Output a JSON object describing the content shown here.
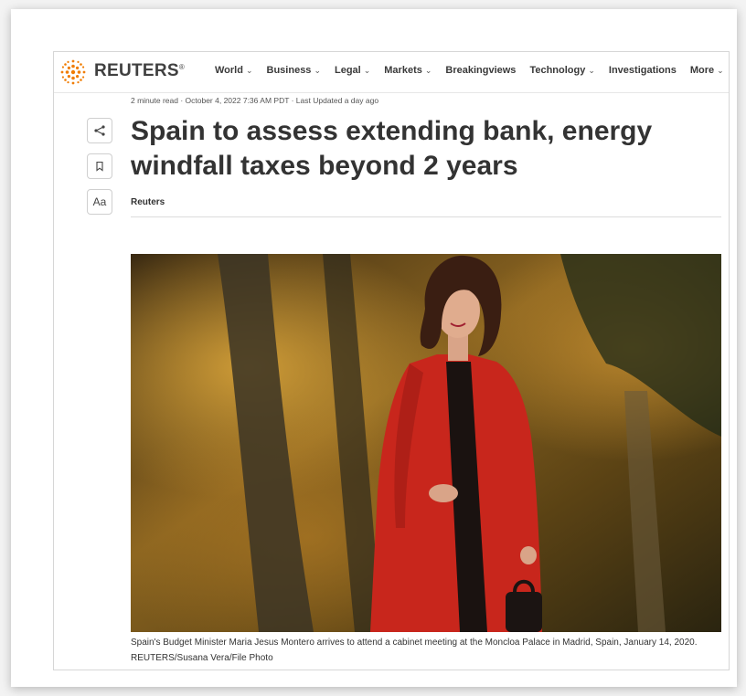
{
  "brand": {
    "name": "REUTERS",
    "mark": "®"
  },
  "nav": [
    {
      "label": "World",
      "dropdown": true
    },
    {
      "label": "Business",
      "dropdown": true
    },
    {
      "label": "Legal",
      "dropdown": true
    },
    {
      "label": "Markets",
      "dropdown": true
    },
    {
      "label": "Breakingviews",
      "dropdown": false
    },
    {
      "label": "Technology",
      "dropdown": true
    },
    {
      "label": "Investigations",
      "dropdown": false
    },
    {
      "label": "More",
      "dropdown": true
    }
  ],
  "article": {
    "meta": "2 minute read · October 4, 2022 7:36 AM PDT · Last Updated a day ago",
    "headline": "Spain to assess extending bank, energy windfall taxes beyond 2 years",
    "byline": "Reuters",
    "caption": "Spain's Budget Minister Maria Jesus Montero arrives to attend a cabinet meeting at the Moncloa Palace in Madrid, Spain, January 14, 2020. REUTERS/Susana Vera/File Photo"
  },
  "tools": {
    "share_icon": "share-icon",
    "bookmark_icon": "bookmark-icon",
    "font_size_label": "Aa"
  },
  "colors": {
    "logo_orange": "#f07c00",
    "text_dark": "#333333",
    "coat_red": "#c8261c"
  }
}
